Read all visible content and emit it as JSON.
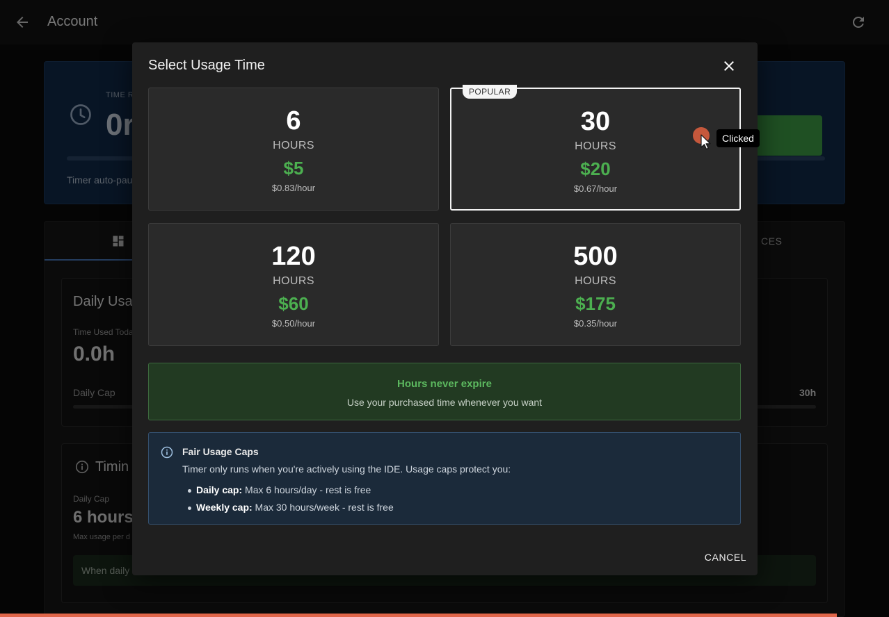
{
  "appbar": {
    "title": "Account"
  },
  "time_card": {
    "label": "TIME R",
    "value": "0r",
    "autopause": "Timer auto-pau"
  },
  "tabs": {
    "last_label": "CES"
  },
  "daily_usage": {
    "title": "Daily Usa",
    "used_label": "Time Used Toda",
    "used_value": "0.0h",
    "cap_label": "Daily Cap",
    "cap_max": "30h"
  },
  "timing": {
    "title": "Timin",
    "cap_label": "Daily Cap",
    "cap_value": "6 hours",
    "cap_note": "Max usage per d",
    "alert_text": "When daily"
  },
  "dialog": {
    "title": "Select Usage Time",
    "plans": [
      {
        "hours": "6",
        "unit": "HOURS",
        "price": "$5",
        "rate": "$0.83/hour"
      },
      {
        "hours": "30",
        "unit": "HOURS",
        "price": "$20",
        "rate": "$0.67/hour",
        "badge": "POPULAR"
      },
      {
        "hours": "120",
        "unit": "HOURS",
        "price": "$60",
        "rate": "$0.50/hour"
      },
      {
        "hours": "500",
        "unit": "HOURS",
        "price": "$175",
        "rate": "$0.35/hour"
      }
    ],
    "expire": {
      "title": "Hours never expire",
      "subtitle": "Use your purchased time whenever you want"
    },
    "caps": {
      "title": "Fair Usage Caps",
      "description": "Timer only runs when you're actively using the IDE. Usage caps protect you:",
      "daily_label": "Daily cap:",
      "daily_text": " Max 6 hours/day - rest is free",
      "weekly_label": "Weekly cap:",
      "weekly_text": " Max 30 hours/week - rest is free"
    },
    "cancel_label": "CANCEL"
  },
  "overlay": {
    "tooltip": "Clicked"
  },
  "colors": {
    "accent_green": "#4caf50",
    "time_card_bg": "#102a4a",
    "progress_strip": "#e0664a"
  },
  "icons": [
    "arrow-left-icon",
    "refresh-icon",
    "clock-icon",
    "dashboard-icon",
    "info-icon",
    "close-icon",
    "cursor-icon"
  ]
}
